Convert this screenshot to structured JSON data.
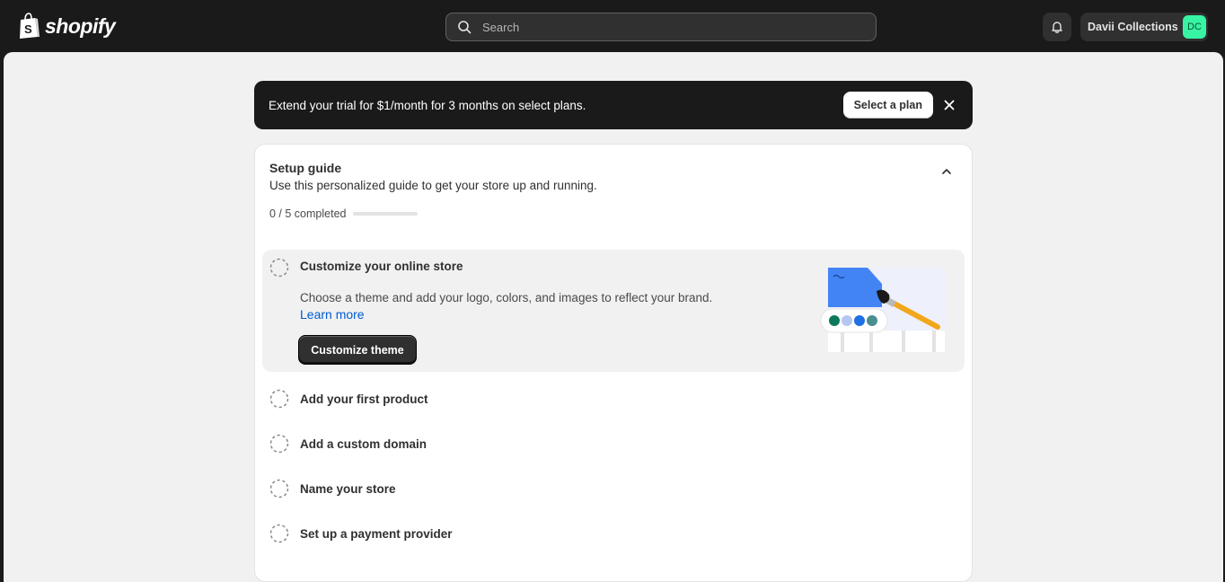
{
  "topbar": {
    "brand": "shopify",
    "search_placeholder": "Search",
    "account_name": "Davii Collections",
    "avatar_initials": "DC",
    "avatar_color": "#36f4a4",
    "logo_color": "#95bf47"
  },
  "banner": {
    "text": "Extend your trial for $1/month for 3 months on select plans.",
    "button_label": "Select a plan"
  },
  "setup_guide": {
    "title": "Setup guide",
    "subtitle": "Use this personalized guide to get your store up and running.",
    "progress_text": "0 / 5 completed",
    "progress_completed": 0,
    "progress_total": 5,
    "active_step": {
      "title": "Customize your online store",
      "description": "Choose a theme and add your logo, colors, and images to reflect your brand.",
      "link_label": "Learn more",
      "button_label": "Customize theme"
    },
    "steps": [
      {
        "label": "Add your first product"
      },
      {
        "label": "Add a custom domain"
      },
      {
        "label": "Name your store"
      },
      {
        "label": "Set up a payment provider"
      }
    ]
  },
  "icons": {
    "search": "search-icon",
    "bell": "bell-icon",
    "close": "close-icon",
    "collapse": "chevron-up-icon",
    "step_status": "dashed-circle-icon"
  },
  "colors": {
    "accent_link": "#005bd3",
    "primary_button": "#303030",
    "illustration_blue": "#4284f4",
    "swatches": [
      "#0c7a5a",
      "#b6c6f2",
      "#1f6fe5",
      "#4a8f8f"
    ]
  }
}
